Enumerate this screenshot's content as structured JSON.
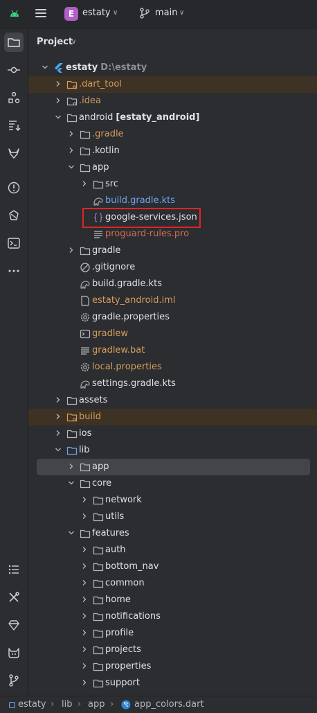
{
  "topbar": {
    "project_badge": "E",
    "project_name": "estaty",
    "branch": "main"
  },
  "panel": {
    "title": "Project"
  },
  "tree": [
    {
      "label": "estaty",
      "extra": "D:\\estaty",
      "icon": "flutter-icon",
      "depth": 0,
      "chev": "open",
      "color": "default",
      "bold": true,
      "row": "normal"
    },
    {
      "label": ".dart_tool",
      "icon": "folder-orange-icon",
      "depth": 1,
      "chev": "closed",
      "color": "orange",
      "row": "excluded"
    },
    {
      "label": ".idea",
      "icon": "folder-idea-icon",
      "depth": 1,
      "chev": "closed",
      "color": "orange",
      "row": "normal"
    },
    {
      "label": "android",
      "extra": "[estaty_android]",
      "icon": "folder-icon",
      "depth": 1,
      "chev": "open",
      "color": "default",
      "row": "normal",
      "extra_bold": true
    },
    {
      "label": ".gradle",
      "icon": "folder-icon",
      "depth": 2,
      "chev": "closed",
      "color": "orange",
      "row": "normal"
    },
    {
      "label": ".kotlin",
      "icon": "folder-icon",
      "depth": 2,
      "chev": "closed",
      "color": "default",
      "row": "normal"
    },
    {
      "label": "app",
      "icon": "folder-icon",
      "depth": 2,
      "chev": "open",
      "color": "default",
      "row": "normal"
    },
    {
      "label": "src",
      "icon": "folder-icon",
      "depth": 3,
      "chev": "closed",
      "color": "default",
      "row": "normal"
    },
    {
      "label": "build.gradle.kts",
      "icon": "gradle-icon",
      "depth": 3,
      "chev": "none",
      "color": "blue",
      "row": "normal"
    },
    {
      "label": "google-services.json",
      "icon": "json-icon",
      "depth": 3,
      "chev": "none",
      "color": "default",
      "row": "normal"
    },
    {
      "label": "proguard-rules.pro",
      "icon": "text-file-icon",
      "depth": 3,
      "chev": "none",
      "color": "red",
      "row": "normal"
    },
    {
      "label": "gradle",
      "icon": "folder-icon",
      "depth": 2,
      "chev": "closed",
      "color": "default",
      "row": "normal"
    },
    {
      "label": ".gitignore",
      "icon": "ignore-icon",
      "depth": 2,
      "chev": "none",
      "color": "default",
      "row": "normal"
    },
    {
      "label": "build.gradle.kts",
      "icon": "gradle-icon",
      "depth": 2,
      "chev": "none",
      "color": "default",
      "row": "normal"
    },
    {
      "label": "estaty_android.iml",
      "icon": "file-icon",
      "depth": 2,
      "chev": "none",
      "color": "orange",
      "row": "normal"
    },
    {
      "label": "gradle.properties",
      "icon": "gear-icon",
      "depth": 2,
      "chev": "none",
      "color": "default",
      "row": "normal"
    },
    {
      "label": "gradlew",
      "icon": "terminal-file-icon",
      "depth": 2,
      "chev": "none",
      "color": "orange",
      "row": "normal"
    },
    {
      "label": "gradlew.bat",
      "icon": "text-file-icon",
      "depth": 2,
      "chev": "none",
      "color": "orange",
      "row": "normal"
    },
    {
      "label": "local.properties",
      "icon": "gear-icon",
      "depth": 2,
      "chev": "none",
      "color": "orange",
      "row": "normal"
    },
    {
      "label": "settings.gradle.kts",
      "icon": "gradle-icon",
      "depth": 2,
      "chev": "none",
      "color": "default",
      "row": "normal"
    },
    {
      "label": "assets",
      "icon": "folder-icon",
      "depth": 1,
      "chev": "closed",
      "color": "default",
      "row": "normal"
    },
    {
      "label": "build",
      "icon": "folder-orange-icon",
      "depth": 1,
      "chev": "closed",
      "color": "orange",
      "row": "excluded"
    },
    {
      "label": "ios",
      "icon": "folder-icon",
      "depth": 1,
      "chev": "closed",
      "color": "default",
      "row": "normal"
    },
    {
      "label": "lib",
      "icon": "folder-blue-icon",
      "depth": 1,
      "chev": "open",
      "color": "default",
      "row": "normal"
    },
    {
      "label": "app",
      "icon": "folder-icon",
      "depth": 2,
      "chev": "closed",
      "color": "default",
      "row": "selected"
    },
    {
      "label": "core",
      "icon": "folder-icon",
      "depth": 2,
      "chev": "open",
      "color": "default",
      "row": "normal"
    },
    {
      "label": "network",
      "icon": "folder-icon",
      "depth": 3,
      "chev": "closed",
      "color": "default",
      "row": "normal"
    },
    {
      "label": "utils",
      "icon": "folder-icon",
      "depth": 3,
      "chev": "closed",
      "color": "default",
      "row": "normal"
    },
    {
      "label": "features",
      "icon": "folder-icon",
      "depth": 2,
      "chev": "open",
      "color": "default",
      "row": "normal"
    },
    {
      "label": "auth",
      "icon": "folder-icon",
      "depth": 3,
      "chev": "closed",
      "color": "default",
      "row": "normal"
    },
    {
      "label": "bottom_nav",
      "icon": "folder-icon",
      "depth": 3,
      "chev": "closed",
      "color": "default",
      "row": "normal"
    },
    {
      "label": "common",
      "icon": "folder-icon",
      "depth": 3,
      "chev": "closed",
      "color": "default",
      "row": "normal"
    },
    {
      "label": "home",
      "icon": "folder-icon",
      "depth": 3,
      "chev": "closed",
      "color": "default",
      "row": "normal"
    },
    {
      "label": "notifications",
      "icon": "folder-icon",
      "depth": 3,
      "chev": "closed",
      "color": "default",
      "row": "normal"
    },
    {
      "label": "profile",
      "icon": "folder-icon",
      "depth": 3,
      "chev": "closed",
      "color": "default",
      "row": "normal"
    },
    {
      "label": "projects",
      "icon": "folder-icon",
      "depth": 3,
      "chev": "closed",
      "color": "default",
      "row": "normal"
    },
    {
      "label": "properties",
      "icon": "folder-icon",
      "depth": 3,
      "chev": "closed",
      "color": "default",
      "row": "normal"
    },
    {
      "label": "support",
      "icon": "folder-icon",
      "depth": 3,
      "chev": "closed",
      "color": "default",
      "row": "normal"
    }
  ],
  "breadcrumbs": [
    "estaty",
    "lib",
    "app",
    "app_colors.dart"
  ],
  "colors": {
    "background": "#2b2d30",
    "excluded_row": "#3d3223",
    "selected_row": "#43454a",
    "highlight": "#e0242a",
    "text_orange": "#d59c5e",
    "text_blue": "#6ea6f5",
    "text_red": "#d56a58"
  }
}
